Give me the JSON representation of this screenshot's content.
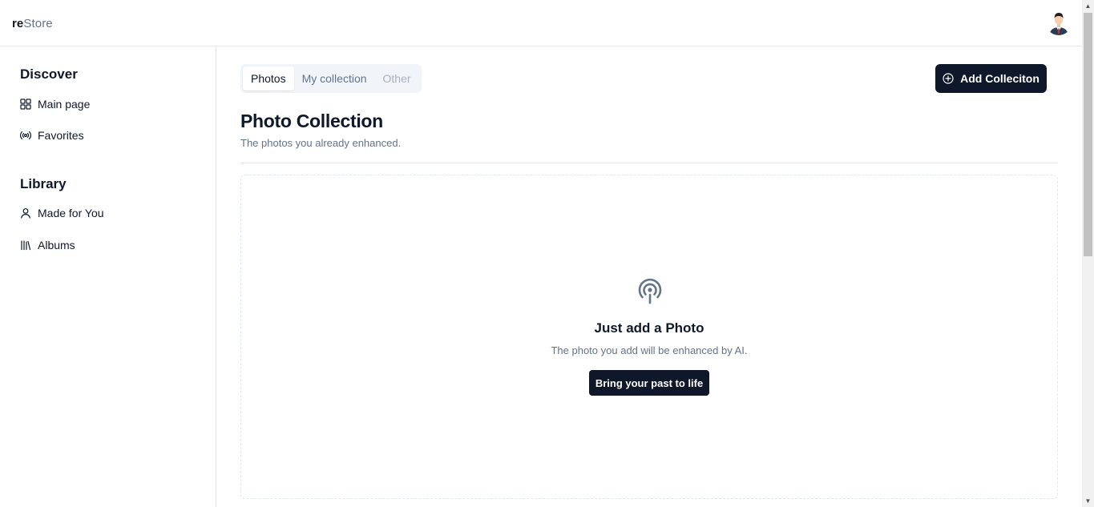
{
  "app": {
    "logo_strong": "re",
    "logo_light": "Store",
    "avatar_icon": "user-avatar-icon"
  },
  "sidebar": {
    "discover_title": "Discover",
    "discover_items": [
      {
        "label": "Main page",
        "icon": "grid-icon"
      },
      {
        "label": "Favorites",
        "icon": "broadcast-icon"
      }
    ],
    "library_title": "Library",
    "library_items": [
      {
        "label": "Made for You",
        "icon": "user-icon"
      },
      {
        "label": "Albums",
        "icon": "library-icon"
      }
    ]
  },
  "main": {
    "tabs": [
      {
        "label": "Photos",
        "state": "active"
      },
      {
        "label": "My collection",
        "state": "inactive"
      },
      {
        "label": "Other",
        "state": "disabled"
      }
    ],
    "add_button_label": "Add Colleciton",
    "add_button_icon": "plus-circle-icon",
    "title": "Photo Collection",
    "subtitle": "The photos you already enhanced.",
    "empty_state": {
      "icon": "podcast-icon",
      "title": "Just add a Photo",
      "description": "The photo you add will be enhanced by AI.",
      "cta_label": "Bring your past to life"
    }
  },
  "colors": {
    "primary": "#0f172a",
    "muted_text": "#64748b",
    "border": "#e5e7eb",
    "tab_bg": "#f1f5f9"
  }
}
